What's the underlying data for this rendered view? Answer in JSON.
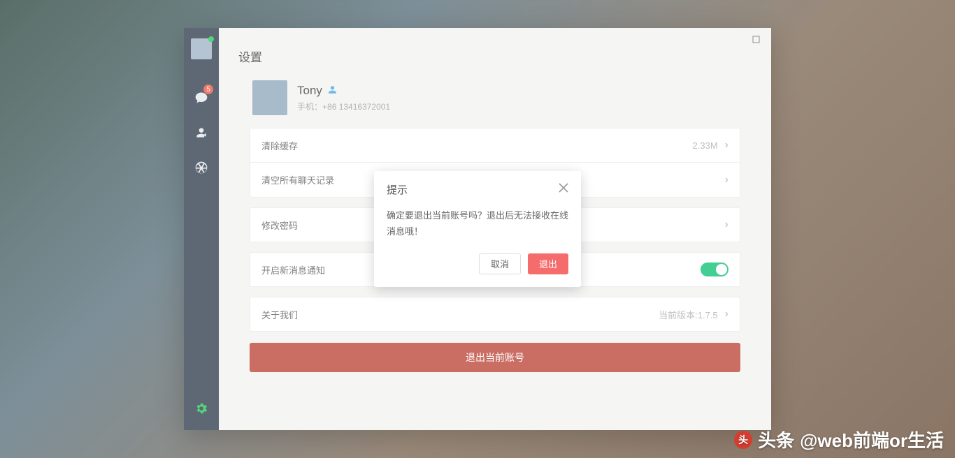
{
  "page": {
    "title": "设置"
  },
  "sidebar": {
    "badge": "5"
  },
  "profile": {
    "name": "Tony",
    "phone_label": "手机：",
    "phone": "+86 13416372001"
  },
  "rows": {
    "clear_cache": {
      "label": "清除缓存",
      "value": "2.33M"
    },
    "clear_chat": {
      "label": "清空所有聊天记录"
    },
    "change_pwd": {
      "label": "修改密码"
    },
    "notify": {
      "label": "开启新消息通知",
      "on": true
    },
    "about": {
      "label": "关于我们",
      "value": "当前版本:1.7.5"
    }
  },
  "logout": {
    "label": "退出当前账号"
  },
  "modal": {
    "title": "提示",
    "body": "确定要退出当前账号吗？退出后无法接收在线消息哦！",
    "cancel": "取消",
    "confirm": "退出"
  },
  "watermark": {
    "prefix": "头条",
    "handle": "@web前端or生活"
  }
}
